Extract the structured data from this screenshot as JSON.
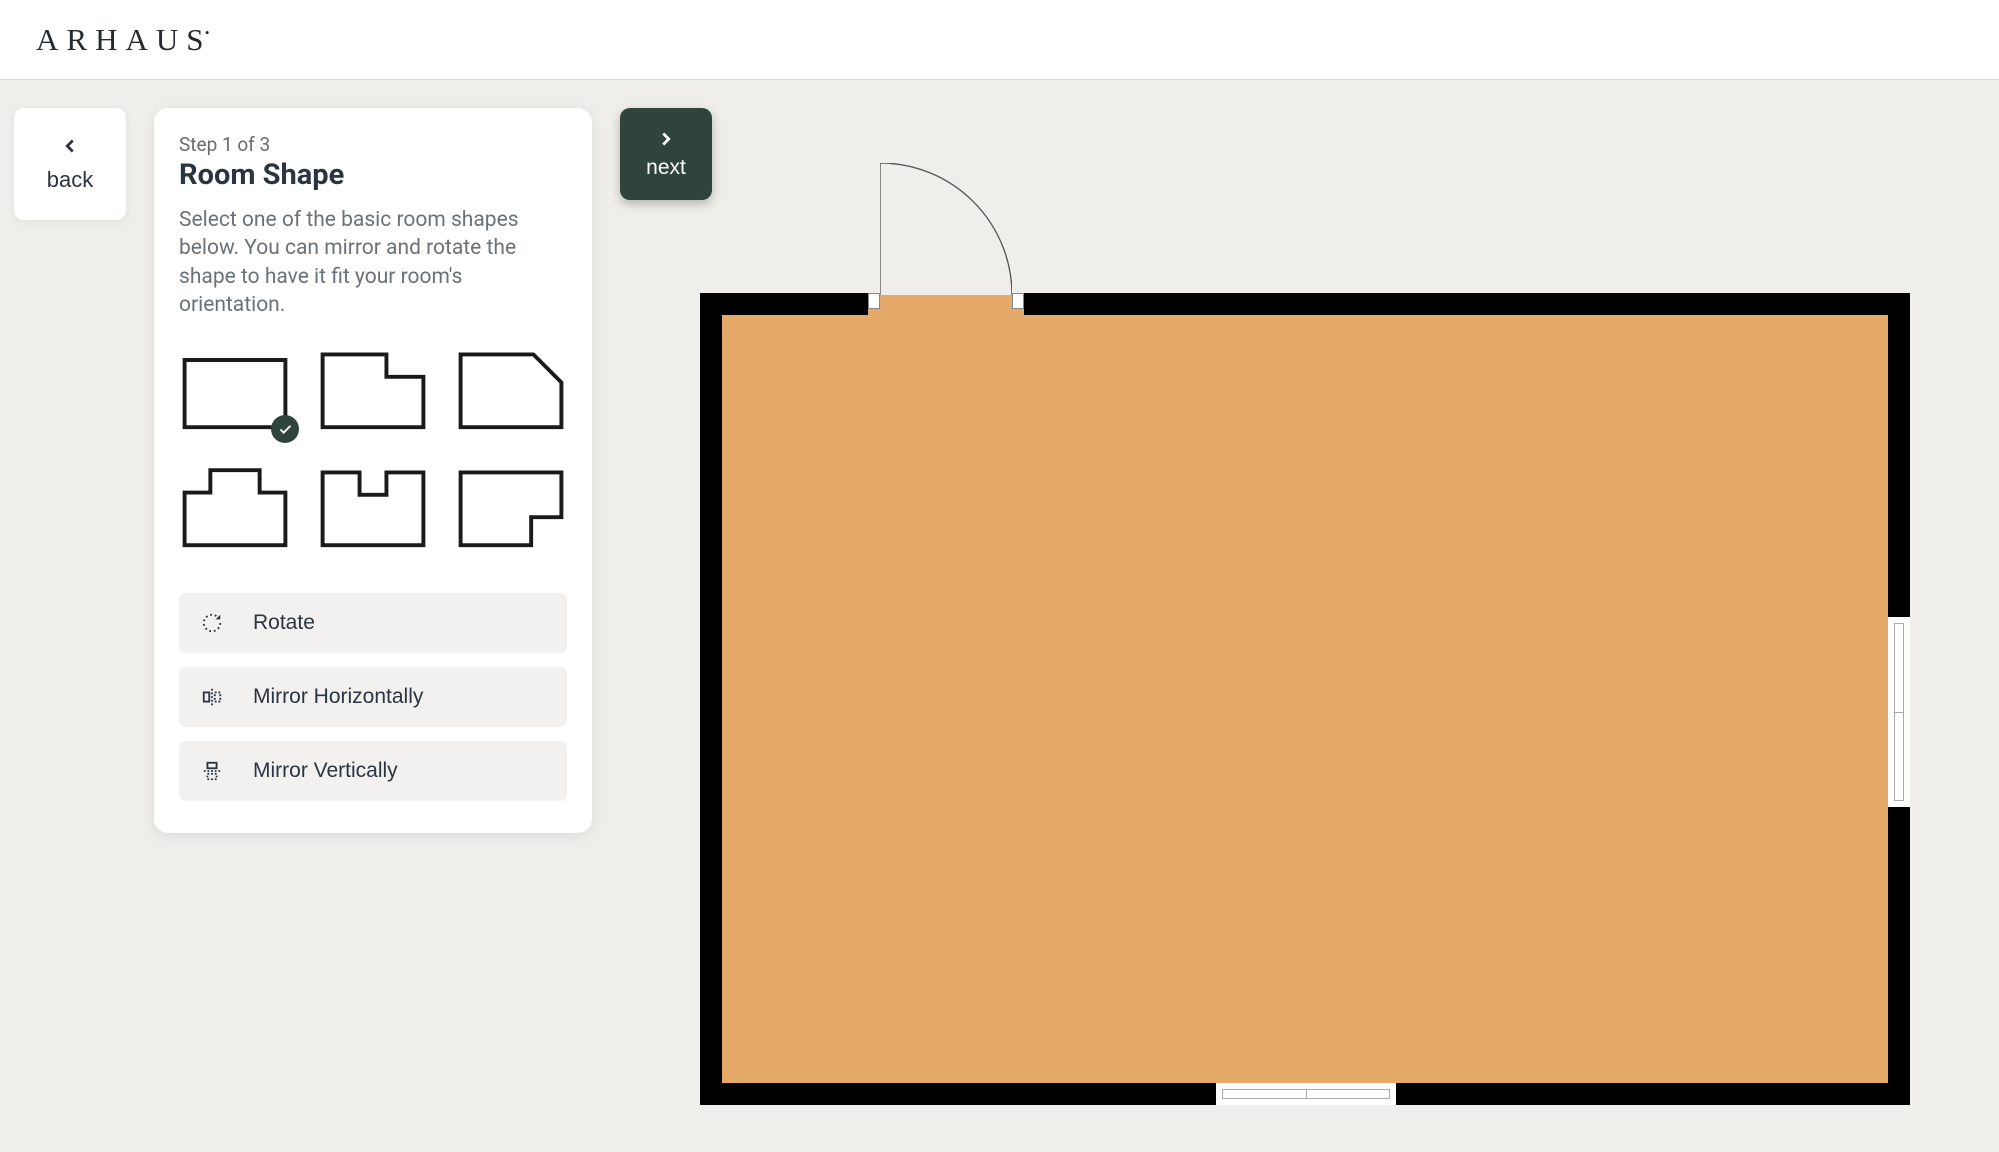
{
  "brand": "ARHAUS",
  "nav": {
    "back_label": "back",
    "next_label": "next"
  },
  "panel": {
    "step_label": "Step 1 of 3",
    "title": "Room Shape",
    "description": "Select one of the basic room shapes below. You can mirror and rotate the shape to have it fit your room's orientation.",
    "shapes": [
      {
        "name": "rectangle",
        "selected": true
      },
      {
        "name": "l-shape-top-right",
        "selected": false
      },
      {
        "name": "chamfered-corner",
        "selected": false
      },
      {
        "name": "t-notch-top",
        "selected": false
      },
      {
        "name": "u-notch-top",
        "selected": false
      },
      {
        "name": "l-shape-bottom-right",
        "selected": false
      }
    ],
    "actions": {
      "rotate": "Rotate",
      "mirror_h": "Mirror Horizontally",
      "mirror_v": "Mirror Vertically"
    }
  }
}
